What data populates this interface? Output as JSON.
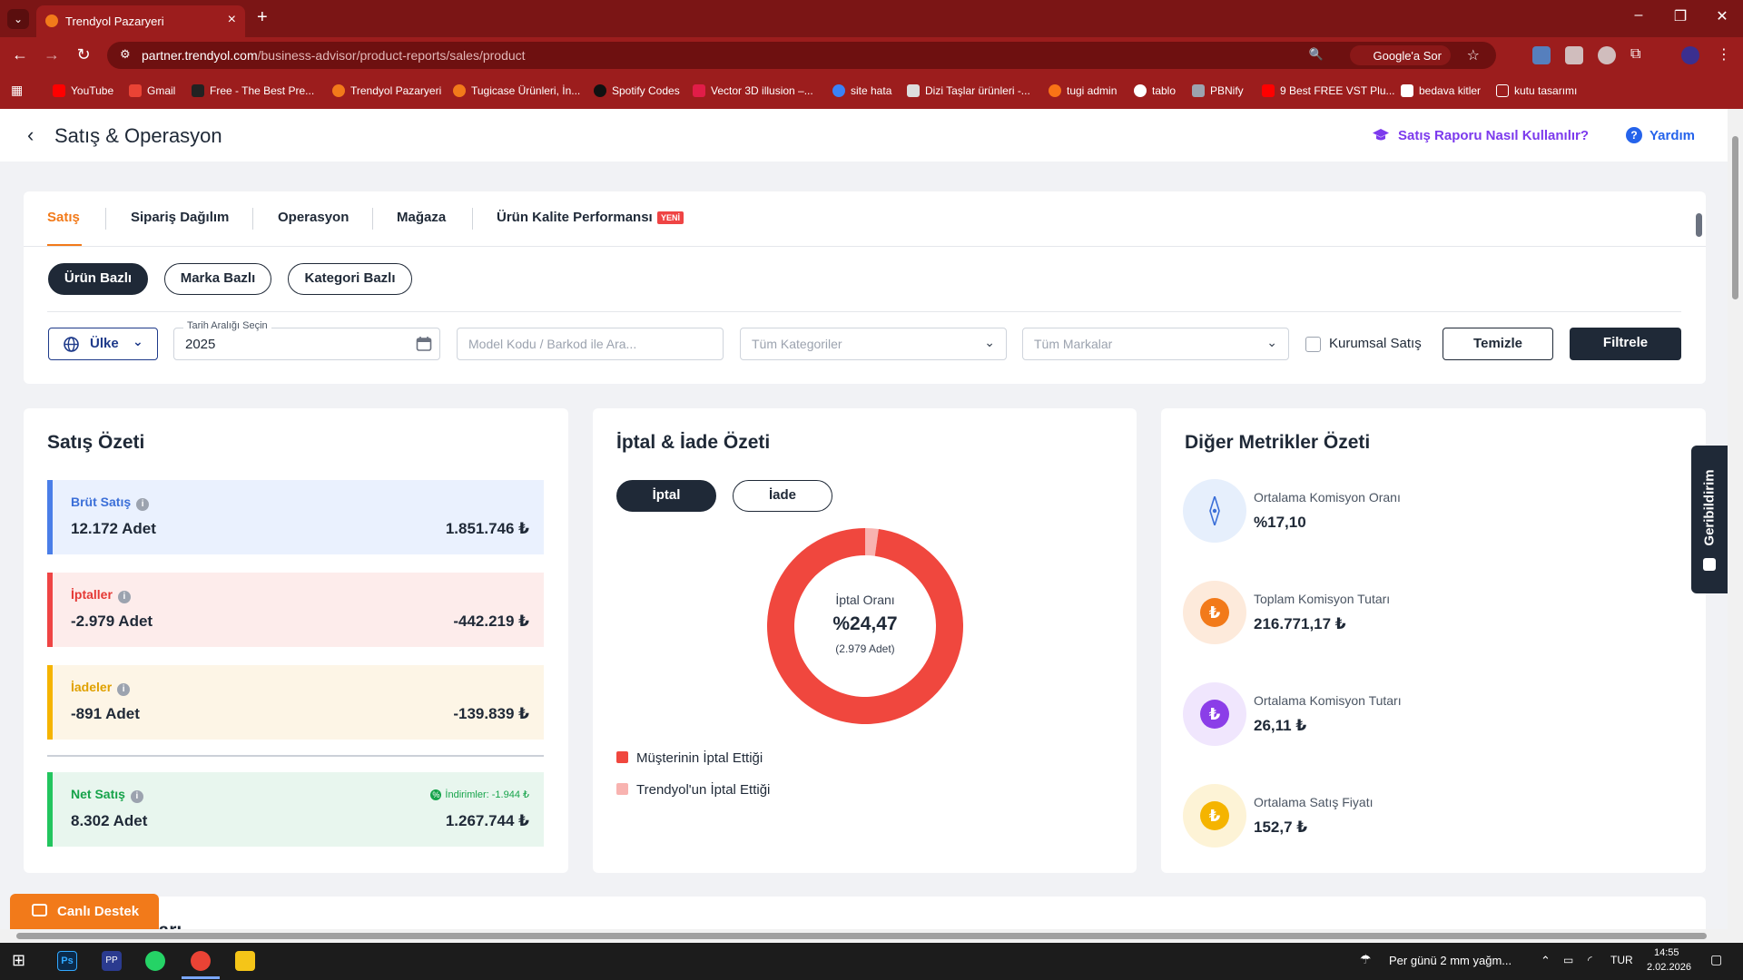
{
  "browser": {
    "tab_title": "Trendyol Pazaryeri",
    "url_host": "partner.trendyol.com",
    "url_path": "/business-advisor/product-reports/sales/product",
    "google_lens": "Google'a Sor",
    "bookmarks": [
      "YouTube",
      "Gmail",
      "Free - The Best Pre...",
      "Trendyol Pazaryeri",
      "Tugicase Ürünleri, İn...",
      "Spotify Codes",
      "Vector 3D illusion –...",
      "site hata",
      "Dizi Taşlar ürünleri -...",
      "tugi admin",
      "tablo",
      "PBNify",
      "9 Best FREE VST Plu...",
      "bedava kitler",
      "kutu tasarımı"
    ]
  },
  "header": {
    "title": "Satış & Operasyon",
    "help_link": "Satış Raporu Nasıl Kullanılır?",
    "help": "Yardım"
  },
  "tabs": [
    "Satış",
    "Sipariş Dağılım",
    "Operasyon",
    "Mağaza",
    "Ürün Kalite Performansı"
  ],
  "new_badge": "YENİ",
  "view_pills": [
    "Ürün Bazlı",
    "Marka Bazlı",
    "Kategori Bazlı"
  ],
  "filters": {
    "country": "Ülke",
    "date_label": "Tarih Aralığı Seçin",
    "date_value": "2025",
    "search_placeholder": "Model Kodu / Barkod ile Ara...",
    "category_placeholder": "Tüm Kategoriler",
    "brand_placeholder": "Tüm Markalar",
    "corporate": "Kurumsal Satış",
    "clear": "Temizle",
    "filter": "Filtrele"
  },
  "sales_summary": {
    "title": "Satış Özeti",
    "items": [
      {
        "name": "Brüt Satış",
        "count": "12.172 Adet",
        "amount": "1.851.746 ₺"
      },
      {
        "name": "İptaller",
        "count": "-2.979 Adet",
        "amount": "-442.219 ₺"
      },
      {
        "name": "İadeler",
        "count": "-891 Adet",
        "amount": "-139.839 ₺"
      },
      {
        "name": "Net Satış",
        "count": "8.302 Adet",
        "amount": "1.267.744 ₺",
        "discount": "İndirimler: -1.944 ₺"
      }
    ]
  },
  "cancel_summary": {
    "title": "İptal & İade Özeti",
    "toggle": [
      "İptal",
      "İade"
    ],
    "center_label": "İptal Oranı",
    "center_value": "%24,47",
    "center_sub": "(2.979 Adet)",
    "legend": [
      "Müşterinin İptal Ettiği",
      "Trendyol'un İptal Ettiği"
    ]
  },
  "chart_data": {
    "type": "pie",
    "title": "",
    "categories": [
      "Müşterinin İptal Ettiği",
      "Trendyol'un İptal Ettiği"
    ],
    "values": [
      97.8,
      2.2
    ],
    "colors": [
      "#f0473e",
      "#f8b3b0"
    ]
  },
  "other_metrics": {
    "title": "Diğer Metrikler Özeti",
    "items": [
      {
        "label": "Ortalama Komisyon Oranı",
        "value": "%17,10"
      },
      {
        "label": "Toplam Komisyon Tutarı",
        "value": "216.771,17 ₺"
      },
      {
        "label": "Ortalama Komisyon Tutarı",
        "value": "26,11 ₺"
      },
      {
        "label": "Ortalama Satış Fiyatı",
        "value": "152,7 ₺"
      }
    ]
  },
  "next_section_title": "Satış Raporları",
  "live_support": "Canlı Destek",
  "feedback": "Geribildirim",
  "taskbar": {
    "weather": "Per günü 2 mm yağm...",
    "lang": "TUR",
    "time": "14:55",
    "date": "2.02.2026"
  }
}
